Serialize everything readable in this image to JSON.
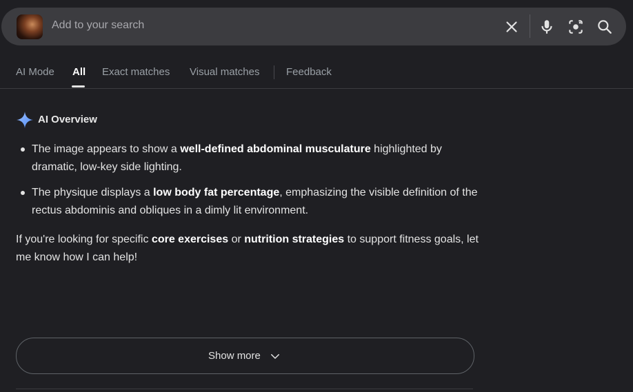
{
  "search": {
    "placeholder": "Add to your search",
    "thumbnail_alt": "image thumbnail"
  },
  "tabs": [
    {
      "label": "AI Mode"
    },
    {
      "label": "All"
    },
    {
      "label": "Exact matches"
    },
    {
      "label": "Visual matches"
    },
    {
      "label": "Feedback"
    }
  ],
  "active_tab": "All",
  "ai_overview": {
    "title": "AI Overview",
    "bullets": [
      {
        "pre": "The image appears to show a ",
        "bold": "well-defined abdominal musculature",
        "post": " highlighted by dramatic, low-key side lighting."
      },
      {
        "pre": "The physique displays a ",
        "bold": "low body fat percentage",
        "post": ", emphasizing the visible definition of the rectus abdominis and obliques in a dimly lit environment."
      }
    ],
    "closing": {
      "pre": "If you're looking for specific ",
      "bold1": "core exercises",
      "mid": " or ",
      "bold2": "nutrition strategies",
      "post": " to support fitness goals, let me know how I can help!"
    }
  },
  "show_more": {
    "label": "Show more"
  },
  "icons": {
    "clear": "close-icon",
    "voice": "microphone-icon",
    "lens": "camera-lens-icon",
    "search": "search-icon",
    "sparkle": "sparkle-icon",
    "chevron": "chevron-down-icon"
  },
  "colors": {
    "background": "#1f1f23",
    "search_bar": "#3c3c40",
    "text": "#e3e3e3",
    "muted": "#9aa0a6",
    "sparkle_blue": "#4f8bf5"
  }
}
